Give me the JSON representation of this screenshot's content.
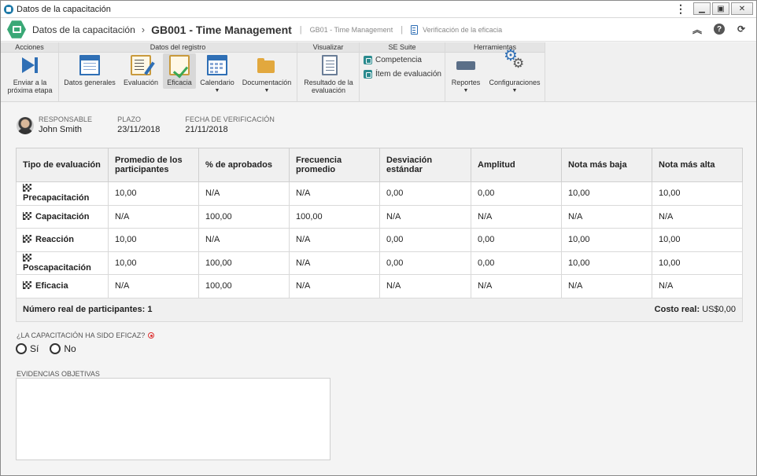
{
  "window": {
    "title": "Datos de la capacitación",
    "menu_icon": "kebab-menu-icon",
    "minimize_icon": "minimize-icon",
    "maximize_icon": "maximize-icon",
    "close_icon": "close-icon"
  },
  "header": {
    "breadcrumb_root": "Datos de la capacitación",
    "separator": "›",
    "breadcrumb_current": "GB001 - Time Management",
    "link1": "GB01 - Time Management",
    "link2": "Verificación de la eficacia",
    "help_glyph": "?"
  },
  "ribbon": {
    "groups": {
      "acciones": "Acciones",
      "datos_registro": "Datos del registro",
      "visualizar": "Visualizar",
      "se_suite": "SE Suite",
      "herramientas": "Herramientas"
    },
    "buttons": {
      "enviar": "Enviar a la próxima etapa",
      "datos_generales": "Datos generales",
      "evaluacion": "Evaluación",
      "eficacia": "Eficacia",
      "calendario": "Calendario",
      "documentacion": "Documentación",
      "resultado": "Resultado de la evaluación",
      "competencia": "Competencia",
      "item_evaluacion": "Ítem de evaluación",
      "reportes": "Reportes",
      "configuraciones": "Configuraciones"
    },
    "dropdown_caret": "▼",
    "active_button": "Eficacia"
  },
  "info": {
    "responsable_label": "RESPONSABLE",
    "responsable_value": "John Smith",
    "plazo_label": "PLAZO",
    "plazo_value": "23/11/2018",
    "fecha_label": "FECHA DE VERIFICACIÓN",
    "fecha_value": "21/11/2018"
  },
  "table": {
    "headers": [
      "Tipo de evaluación",
      "Promedio de los participantes",
      "% de aprobados",
      "Frecuencia promedio",
      "Desviación estándar",
      "Amplitud",
      "Nota más baja",
      "Nota más alta"
    ],
    "rows": [
      [
        "Precapacitación",
        "10,00",
        "N/A",
        "N/A",
        "0,00",
        "0,00",
        "10,00",
        "10,00"
      ],
      [
        "Capacitación",
        "N/A",
        "100,00",
        "100,00",
        "N/A",
        "N/A",
        "N/A",
        "N/A"
      ],
      [
        "Reacción",
        "10,00",
        "N/A",
        "N/A",
        "0,00",
        "0,00",
        "10,00",
        "10,00"
      ],
      [
        "Poscapacitación",
        "10,00",
        "100,00",
        "N/A",
        "0,00",
        "0,00",
        "10,00",
        "10,00"
      ],
      [
        "Eficacia",
        "N/A",
        "100,00",
        "N/A",
        "N/A",
        "N/A",
        "N/A",
        "N/A"
      ]
    ],
    "footer_participants": "Número real de participantes: 1",
    "footer_cost_label": "Costo real:",
    "footer_cost_value": "US$0,00"
  },
  "form": {
    "question": "¿LA CAPACITACIÓN HA SIDO EFICAZ?",
    "option_yes": "Sí",
    "option_no": "No",
    "evidence_label": "EVIDENCIAS OBJETIVAS",
    "evidence_value": ""
  }
}
